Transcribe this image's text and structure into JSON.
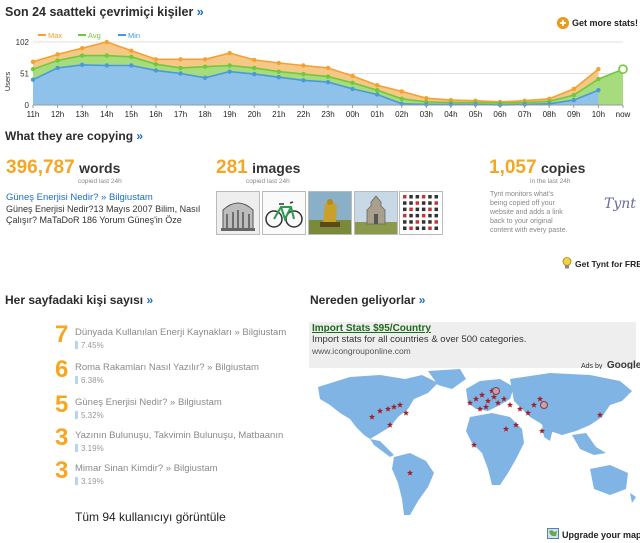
{
  "colors": {
    "max": "#f5a030",
    "avg": "#73c83a",
    "min": "#4a9ad8",
    "accent_orange": "#f5a623",
    "link_blue": "#1b6ec2"
  },
  "online": {
    "title": "Son 24 saatteki çevrimiçi kişiler",
    "raquo": "»",
    "get_stats": "Get more stats!",
    "get_stats_icon": "green-plus-icon"
  },
  "chart_data": {
    "type": "area",
    "x": [
      "11h",
      "12h",
      "13h",
      "14h",
      "15h",
      "16h",
      "17h",
      "18h",
      "19h",
      "20h",
      "21h",
      "22h",
      "23h",
      "00h",
      "01h",
      "02h",
      "03h",
      "04h",
      "05h",
      "06h",
      "07h",
      "08h",
      "09h",
      "10h",
      "now"
    ],
    "ylabel": "Users",
    "ylim": [
      0,
      102
    ],
    "yticks": [
      0,
      51,
      102
    ],
    "legend": [
      "Max",
      "Avg",
      "Min"
    ],
    "legend_position": "top-left",
    "grid": true,
    "series": [
      {
        "name": "Max",
        "values": [
          70,
          82,
          92,
          102,
          88,
          74,
          74,
          74,
          84,
          73,
          68,
          64,
          60,
          47,
          32,
          22,
          11,
          8,
          7,
          5,
          7,
          10,
          26,
          58,
          null
        ]
      },
      {
        "name": "Avg",
        "values": [
          58,
          72,
          80,
          80,
          78,
          66,
          60,
          62,
          64,
          60,
          54,
          50,
          46,
          36,
          24,
          10,
          5,
          4,
          4,
          3,
          4,
          6,
          16,
          42,
          58
        ]
      },
      {
        "name": "Min",
        "values": [
          41,
          60,
          65,
          64,
          64,
          56,
          51,
          44,
          54,
          50,
          45,
          40,
          37,
          26,
          17,
          2,
          1,
          1,
          1,
          0,
          1,
          2,
          8,
          24,
          null
        ]
      }
    ]
  },
  "copying": {
    "title": "What they are copying",
    "raquo": "»",
    "words": {
      "count": "396,787",
      "label": "words",
      "sub": "copied last 24h"
    },
    "images": {
      "count": "281",
      "label": "images",
      "sub": "copied last 24h"
    },
    "copies": {
      "count": "1,057",
      "label": "copies",
      "sub": "in the last 24h"
    },
    "article_link": "Güneş Enerjisi Nedir? » Bilgiustam",
    "snippet": "Güneş Enerjisi Nedir?13 Mayıs 2007 Bilim, Nasıl Çalışır? MaTaDoR 186 Yorum Güneş'in Öze",
    "tynt_text": "Tynt monitors what's being copied off your website and adds a link back to your original content with every paste.",
    "tynt_logo": "Tynt",
    "get_tynt": "Get Tynt for FREE!",
    "get_tynt_icon": "lightbulb-icon",
    "thumbs": [
      "monument-thumbnail",
      "bicycle-thumbnail",
      "statue-painting-thumbnail",
      "castle-painting-thumbnail",
      "icon-grid-thumbnail"
    ]
  },
  "per_page": {
    "title": "Her sayfadaki kişi sayısı",
    "raquo": "»",
    "rows": [
      {
        "rank": "7",
        "title": "Dünyada Kullanılan Enerji Kaynakları » Bilgiustam",
        "pct": "7.45%"
      },
      {
        "rank": "6",
        "title": "Roma Rakamları Nasıl Yazılır? » Bilgiustam",
        "pct": "6.38%"
      },
      {
        "rank": "5",
        "title": "Güneş Enerjisi Nedir? » Bilgiustam",
        "pct": "5.32%"
      },
      {
        "rank": "3",
        "title": "Yazının Bulunuşu, Takvimin Bulunuşu, Matbaanın",
        "pct": "3.19%"
      },
      {
        "rank": "3",
        "title": "Mimar Sinan Kimdir? » Bilgiustam",
        "pct": "3.19%"
      }
    ],
    "view_all": "Tüm 94 kullanıcıyı görüntüle"
  },
  "origin": {
    "title": "Nereden geliyorlar",
    "raquo": "»",
    "ad_title": "Import Stats $95/Country",
    "ad_text": "Import stats for all countries & over 500 categories.",
    "ad_url": "www.icongrouponline.com",
    "ads_by": "Ads by",
    "google": "Google",
    "upgrade": "Upgrade your map!",
    "upgrade_icon": "map-icon"
  }
}
